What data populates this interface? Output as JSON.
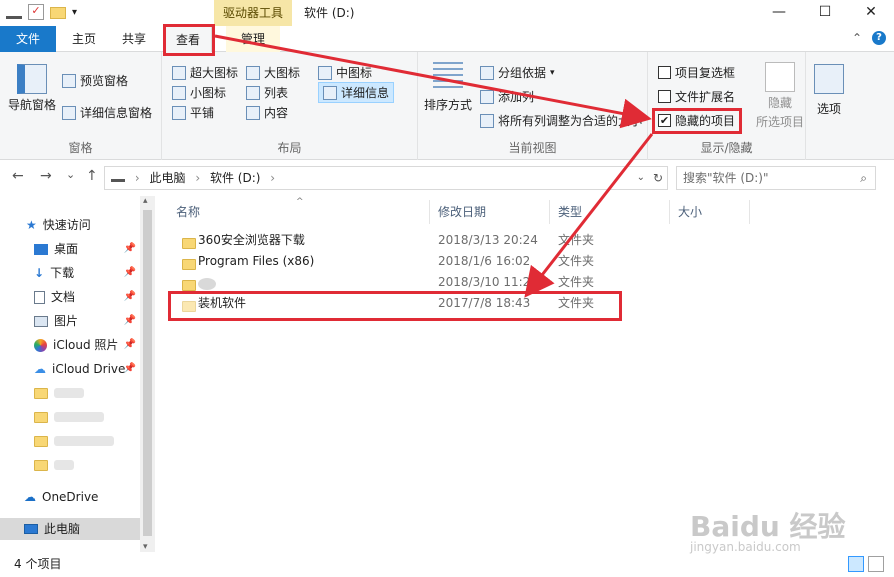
{
  "window": {
    "context_tab_header": "驱动器工具",
    "title": "软件 (D:)",
    "minimize_glyph": "—",
    "maximize_glyph": "☐",
    "close_glyph": "✕"
  },
  "tabs": {
    "file": "文件",
    "home": "主页",
    "share": "共享",
    "view": "查看",
    "manage": "管理",
    "collapse_glyph": "⌃",
    "help_glyph": "?"
  },
  "ribbon": {
    "pane_group": {
      "label": "窗格",
      "nav_pane": "导航窗格",
      "preview_pane": "预览窗格",
      "details_pane": "详细信息窗格"
    },
    "layout_group": {
      "label": "布局",
      "items": [
        "超大图标",
        "大图标",
        "中图标",
        "小图标",
        "列表",
        "详细信息",
        "平铺",
        "内容"
      ]
    },
    "current_view_group": {
      "label": "当前视图",
      "sort_by": "排序方式",
      "group_by": "分组依据",
      "add_columns": "添加列",
      "size_all_columns": "将所有列调整为合适的大小"
    },
    "show_hide_group": {
      "label": "显示/隐藏",
      "item_checkboxes": "项目复选框",
      "item_checkboxes_checked": false,
      "file_extensions": "文件扩展名",
      "file_extensions_checked": false,
      "hidden_items": "隐藏的项目",
      "hidden_items_checked": true,
      "hide_selected": "隐藏",
      "selected_items": "所选项目"
    },
    "options": "选项"
  },
  "address": {
    "back_glyph": "←",
    "forward_glyph": "→",
    "recent_glyph": "⌄",
    "up_glyph": "↑",
    "crumbs": [
      "此电脑",
      "软件 (D:)"
    ],
    "separator": "›",
    "refresh_glyph": "↻",
    "search_placeholder": "搜索\"软件 (D:)\"",
    "search_icon": "search-icon"
  },
  "nav": {
    "quick_access": "快速访问",
    "items": [
      "桌面",
      "下载",
      "文档",
      "图片",
      "iCloud 照片",
      "iCloud Drive"
    ],
    "onedrive": "OneDrive",
    "this_pc": "此电脑"
  },
  "columns": {
    "name": "名称",
    "modified": "修改日期",
    "type": "类型",
    "size": "大小"
  },
  "files": [
    {
      "name": "360安全浏览器下载",
      "modified": "2018/3/13 20:24",
      "type": "文件夹"
    },
    {
      "name": "Program Files (x86)",
      "modified": "2018/1/6 16:02",
      "type": "文件夹"
    },
    {
      "name": "",
      "modified": "2018/3/10 11:20",
      "type": "文件夹"
    },
    {
      "name": "装机软件",
      "modified": "2017/7/8 18:43",
      "type": "文件夹"
    }
  ],
  "status": {
    "item_count": "4 个项目"
  },
  "watermark": {
    "brand": "Baidu 经验",
    "url": "jingyan.baidu.com"
  },
  "colors": {
    "accent": "#1979ca",
    "annotation": "#e02b35",
    "context_tab": "#f6e6a7"
  }
}
